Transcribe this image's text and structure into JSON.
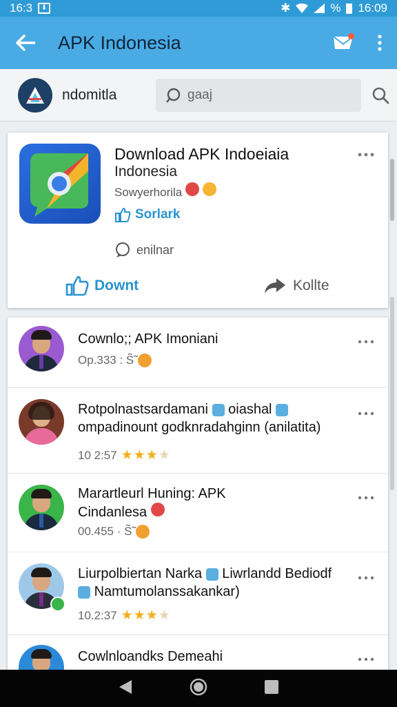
{
  "status_bar": {
    "time_left": "16:3",
    "battery": "%",
    "time_right": "16:09"
  },
  "app_bar": {
    "title": "APK Indonesia"
  },
  "search_row": {
    "site_name": "ndomitla",
    "search_query": "gaaj"
  },
  "hero": {
    "title_line1": "Download APK Indoeiaia",
    "title_line2": "Indonesia",
    "subtitle": "Sowyerhorila",
    "like_label": "Sorlark",
    "comment_label": "enilnar",
    "download_label": "Downt",
    "share_label": "Kollte"
  },
  "items": [
    {
      "title_line1": "Cownlo;; APK Imoniani",
      "title_line2": "",
      "meta": "Op.333 : S̃̃",
      "rating": 0
    },
    {
      "title_line1": "Rotpolnastsardamani",
      "title_line1_extra": "oiashal",
      "title_line2": "ompadinount godknradahginn (anilatita)",
      "meta": "10 2:57",
      "rating": 3
    },
    {
      "title_line1": "Marartleurl Huning: APK",
      "title_line2": "Cindanlesa",
      "meta": "00.455 · S̃̃",
      "rating": 0
    },
    {
      "title_line1": "Liurpolbiertan Narka",
      "title_line1_extra": "Liwrlandd Bediodf",
      "title_line2": "Namtumolanssakankar)",
      "meta": "10.2:37",
      "rating": 3
    },
    {
      "title_line1": "Cowlnloandks Demeahi",
      "title_line2": "",
      "meta": "",
      "rating": 0
    }
  ],
  "colors": {
    "accent": "#4aabe4",
    "status": "#2f9bd6",
    "link": "#2a93d0",
    "star": "#f2b01e"
  }
}
